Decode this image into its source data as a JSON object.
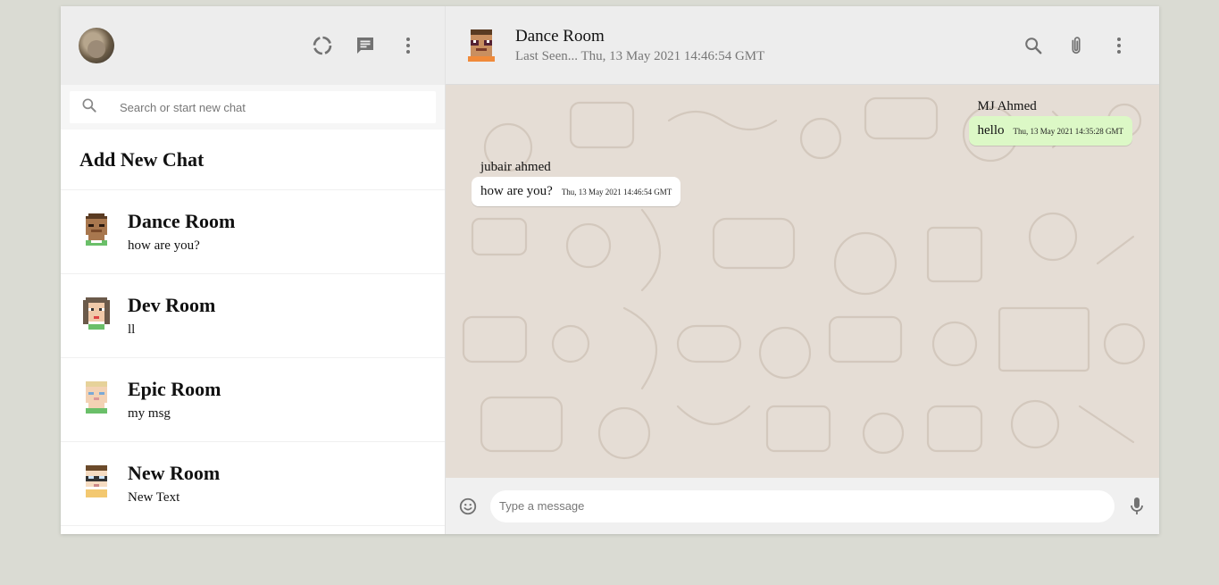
{
  "sidebar": {
    "search": {
      "placeholder": "Search or start new chat"
    },
    "add_chat_label": "Add New Chat",
    "chats": [
      {
        "name": "Dance Room",
        "last_message": "how are you?"
      },
      {
        "name": "Dev Room",
        "last_message": "ll"
      },
      {
        "name": "Epic Room",
        "last_message": "my msg"
      },
      {
        "name": "New Room",
        "last_message": "New Text"
      }
    ]
  },
  "chat": {
    "title": "Dance Room",
    "last_seen": "Last Seen... Thu, 13 May 2021 14:46:54 GMT",
    "messages": [
      {
        "sender": "MJ Ahmed",
        "text": "hello",
        "time": "Thu, 13 May 2021 14:35:28 GMT",
        "direction": "sent"
      },
      {
        "sender": "jubair ahmed",
        "text": "how are you?",
        "time": "Thu, 13 May 2021 14:46:54 GMT",
        "direction": "received"
      }
    ],
    "composer": {
      "placeholder": "Type a message"
    }
  },
  "colors": {
    "sent_bubble": "#dcf8c6",
    "received_bubble": "#ffffff",
    "chat_background": "#e5ddd5",
    "header_background": "#ededed"
  },
  "icons": [
    "status-icon",
    "new-chat-icon",
    "menu-icon",
    "search-icon",
    "attach-icon",
    "emoji-icon",
    "mic-icon"
  ]
}
